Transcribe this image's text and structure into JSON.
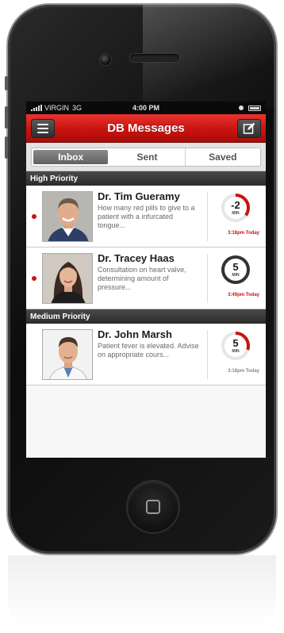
{
  "status_bar": {
    "carrier": "VIRGIN",
    "network": "3G",
    "time": "4:00 PM"
  },
  "header": {
    "title": "DB Messages",
    "menu_icon": "hamburger-icon",
    "compose_icon": "compose-icon"
  },
  "tabs": [
    {
      "label": "Inbox",
      "active": true
    },
    {
      "label": "Sent",
      "active": false
    },
    {
      "label": "Saved",
      "active": false
    }
  ],
  "sections": [
    {
      "title": "High Priority",
      "messages": [
        {
          "name": "Dr. Tim Gueramy",
          "preview": "How many red pills to give to a patient with a infurcated tongue...",
          "timer_value": "-2",
          "timer_unit": "MIN",
          "timer_fraction": 0.35,
          "time": "3:18pm",
          "day": "Today",
          "unread": true,
          "accent": "#c8130f"
        },
        {
          "name": "Dr. Tracey Haas",
          "preview": "Consultation on heart valve, determining amount of pressure...",
          "timer_value": "5",
          "timer_unit": "MIN",
          "timer_fraction": 1.0,
          "time": "3:49pm",
          "day": "Today",
          "unread": true,
          "accent": "#333333"
        }
      ]
    },
    {
      "title": "Medium Priority",
      "messages": [
        {
          "name": "Dr. John Marsh",
          "preview": "Patient fever is elevated. Advise on appropriate cours...",
          "timer_value": "5",
          "timer_unit": "MIN",
          "timer_fraction": 0.3,
          "time": "3:18pm",
          "day": "Today",
          "unread": false,
          "accent": "#c8130f"
        }
      ]
    }
  ]
}
